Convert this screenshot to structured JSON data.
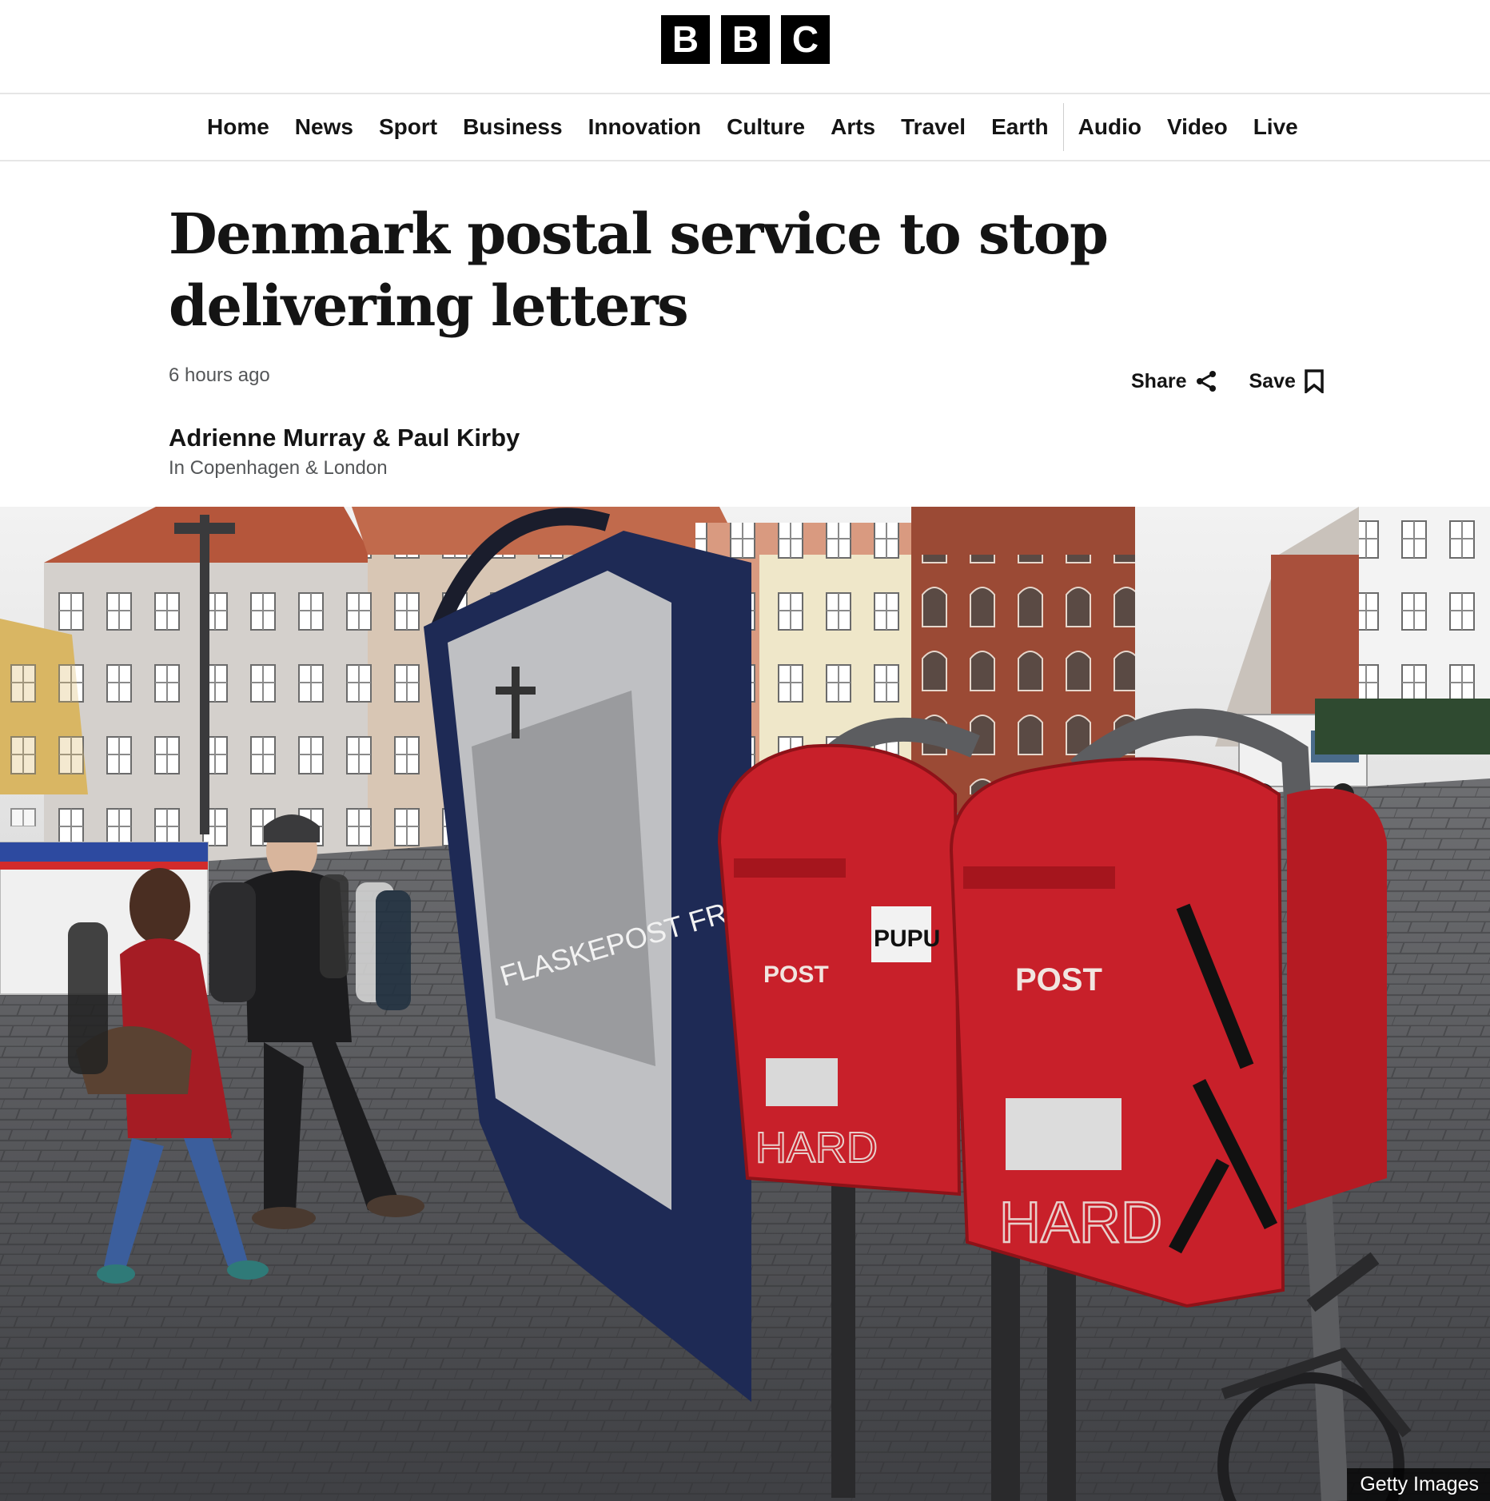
{
  "brand": {
    "letters": [
      "B",
      "B",
      "C"
    ]
  },
  "nav": {
    "primary": [
      "Home",
      "News",
      "Sport",
      "Business",
      "Innovation",
      "Culture",
      "Arts",
      "Travel",
      "Earth"
    ],
    "secondary": [
      "Audio",
      "Video",
      "Live"
    ]
  },
  "article": {
    "headline": "Denmark postal service to stop delivering letters",
    "timestamp": "6 hours ago",
    "byline": "Adrienne Murray & Paul Kirby",
    "location": "In Copenhagen & London",
    "share_label": "Share",
    "save_label": "Save"
  },
  "hero_image": {
    "credit": "Getty Images",
    "signage": {
      "postbox_label": "POST",
      "graffiti_tag": "HARD",
      "sticker": "PUPU",
      "poster_title": "FLASKEPOST FRA P"
    }
  },
  "colors": {
    "text": "#141414",
    "muted": "#545658",
    "postbox_red": "#c8202a",
    "border": "#e6e6e6"
  }
}
